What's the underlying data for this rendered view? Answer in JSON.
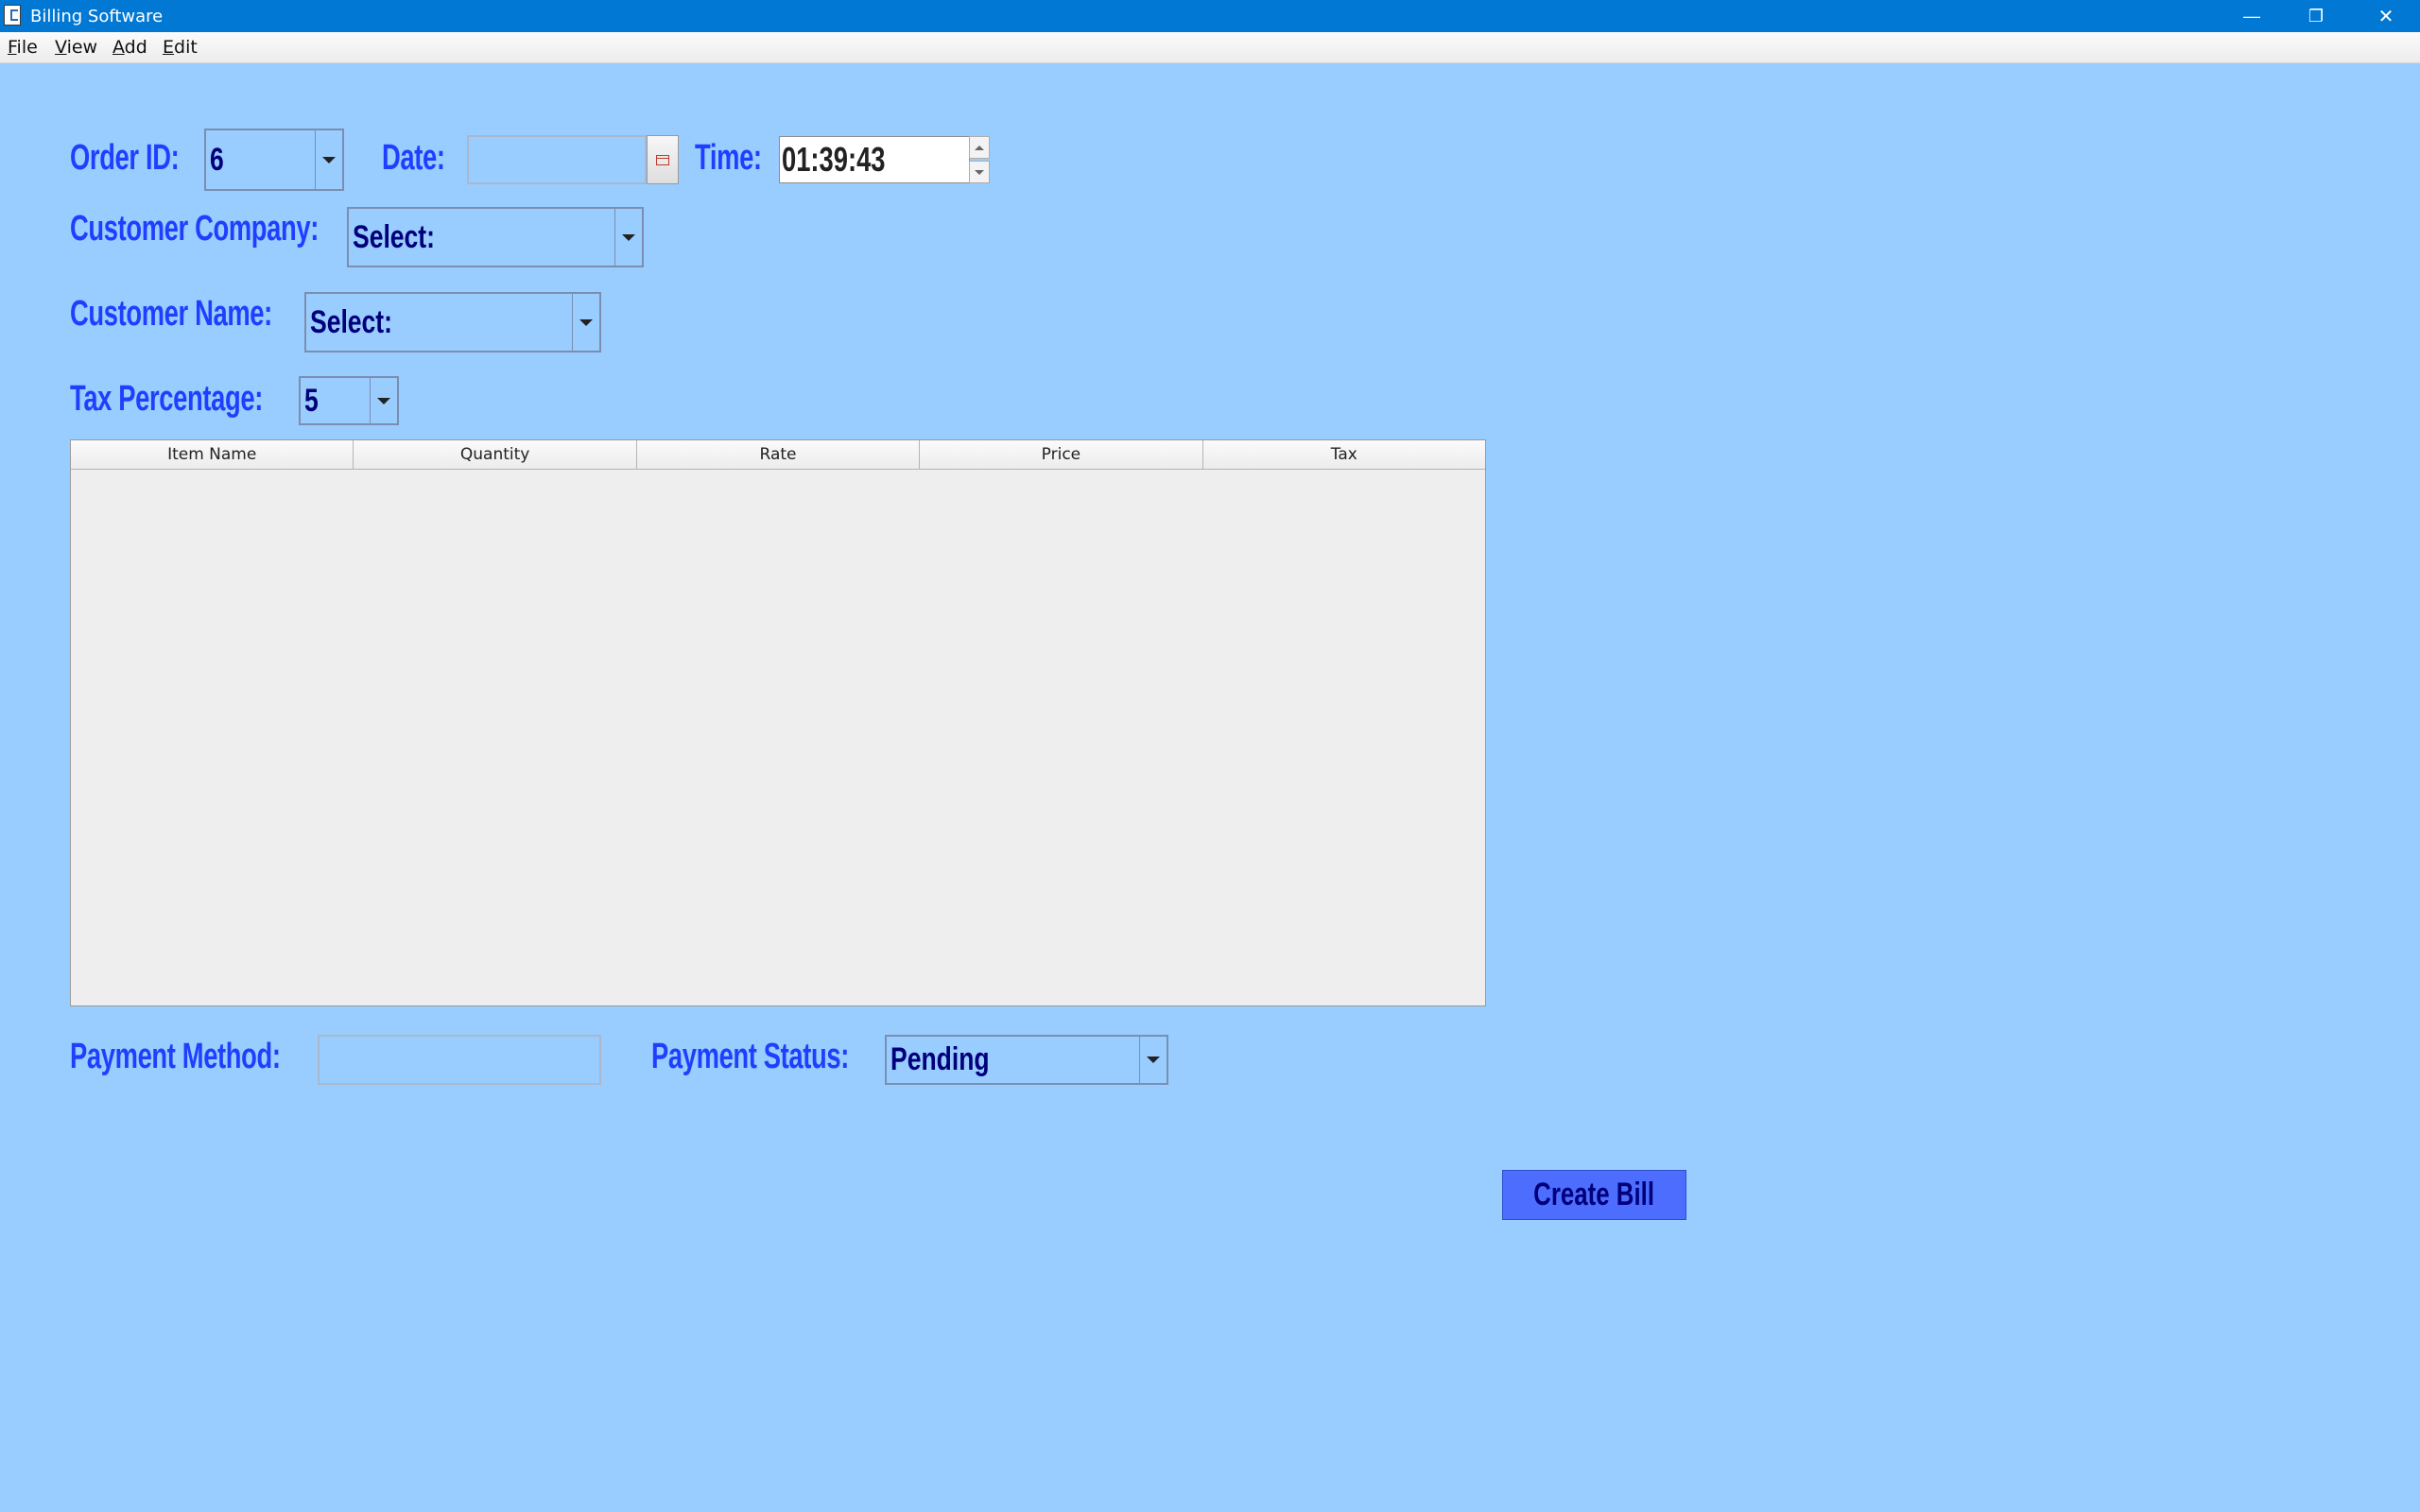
{
  "window": {
    "title": "Billing Software",
    "minimize_glyph": "—",
    "restore_glyph": "❐",
    "close_glyph": "✕"
  },
  "menu": {
    "items": [
      {
        "underline": "F",
        "rest": "ile"
      },
      {
        "underline": "V",
        "rest": "iew"
      },
      {
        "underline": "A",
        "rest": "dd"
      },
      {
        "underline": "E",
        "rest": "dit"
      }
    ]
  },
  "form": {
    "order_id": {
      "label": "Order ID:",
      "value": "6"
    },
    "date": {
      "label": "Date:",
      "value": ""
    },
    "time": {
      "label": "Time:",
      "value": "01:39:43"
    },
    "customer_company": {
      "label": "Customer Company:",
      "value": "Select:"
    },
    "customer_name": {
      "label": "Customer Name:",
      "value": "Select:"
    },
    "tax_percentage": {
      "label": "Tax Percentage:",
      "value": "5"
    },
    "payment_method": {
      "label": "Payment Method:",
      "value": ""
    },
    "payment_status": {
      "label": "Payment Status:",
      "value": "Pending"
    }
  },
  "table": {
    "columns": [
      "Item Name",
      "Quantity",
      "Rate",
      "Price",
      "Tax"
    ],
    "rows": []
  },
  "actions": {
    "create_bill": "Create Bill"
  },
  "colors": {
    "background": "#99ccff",
    "label": "#1f3fff",
    "value": "#00007a",
    "button": "#4d6dff",
    "titlebar": "#0078d4"
  }
}
